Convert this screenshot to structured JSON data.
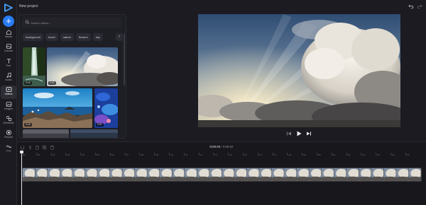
{
  "header": {
    "project_title": "New project",
    "add_label": "+"
  },
  "sidebar": {
    "items": [
      {
        "label": "Media",
        "icon": "home-icon"
      },
      {
        "label": "Canvas",
        "icon": "canvas-icon"
      },
      {
        "label": "Text",
        "icon": "text-icon"
      },
      {
        "label": "Audio",
        "icon": "music-icon"
      },
      {
        "label": "Videos",
        "icon": "video-icon",
        "active": true
      },
      {
        "label": "Images",
        "icon": "image-icon"
      },
      {
        "label": "Elements",
        "icon": "shapes-icon"
      },
      {
        "label": "Record",
        "icon": "record-icon"
      },
      {
        "label": "TTS",
        "icon": "tts-icon"
      }
    ]
  },
  "library": {
    "search_placeholder": "Search videos...",
    "chips": [
      "background",
      "travel",
      "nature",
      "flowers",
      "sky"
    ],
    "chip_next": "›",
    "thumbs": [
      {
        "duration": "0:16",
        "icon": "waterfall-thumbnail"
      },
      {
        "duration": "0:40",
        "icon": "sunbeam-clouds-thumbnail"
      },
      {
        "duration": "0:44",
        "icon": "sea-rocks-thumbnail"
      },
      {
        "duration": "0:07",
        "icon": "coral-thumbnail"
      }
    ]
  },
  "playback": {
    "current_time": "0:00.00",
    "separator": " / ",
    "total_time": "0:08.52"
  },
  "ruler": {
    "ticks": [
      "0:00",
      "0:01",
      "0:02",
      "0:03",
      "0:04",
      "0:05",
      "0:06",
      "0:07",
      "0:08",
      "0:09",
      "0:10",
      "0:11",
      "0:12",
      "0:13",
      "0:14",
      "0:15",
      "0:16",
      "0:17",
      "0:18",
      "0:19",
      "0:20",
      "0:21",
      "0:22",
      "0:23",
      "0:24",
      "0:25",
      "0:26"
    ]
  },
  "colors": {
    "accent": "#2a7cf6",
    "background": "#1b1b21",
    "timeline_bg": "#17171c"
  }
}
